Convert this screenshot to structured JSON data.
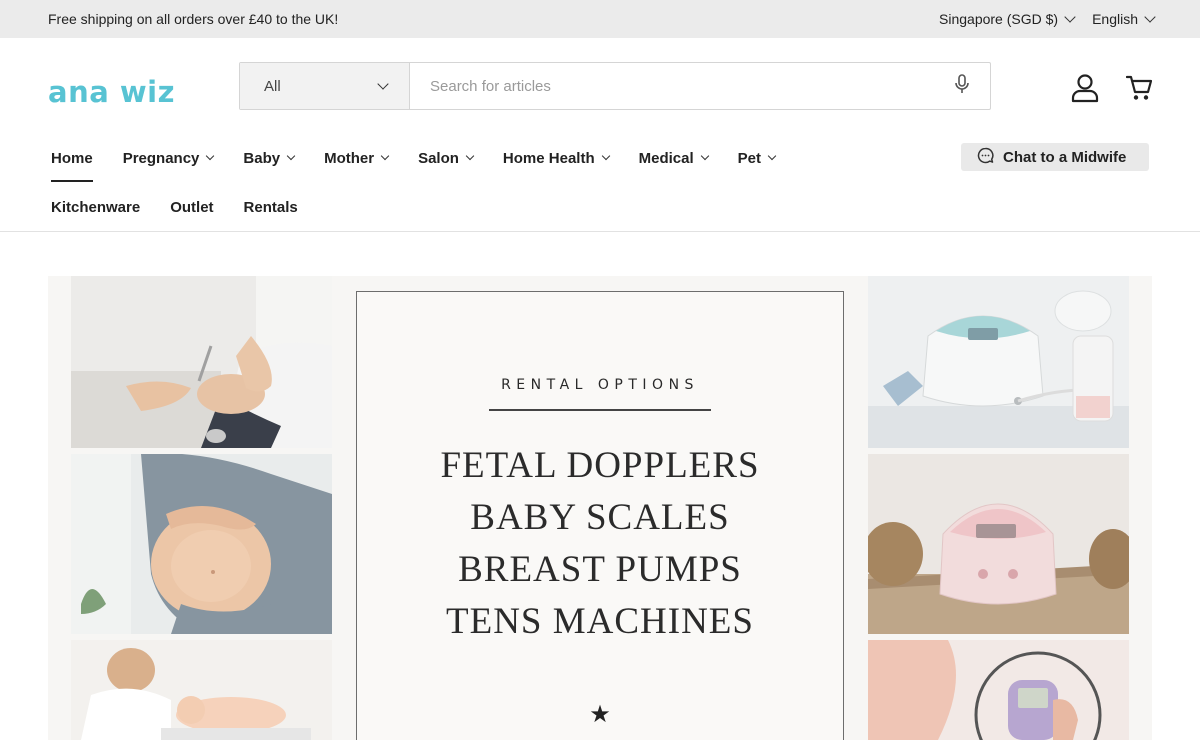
{
  "announcement": {
    "text": "Free shipping on all orders over £40 to the UK!",
    "region": "Singapore (SGD $)",
    "language": "English"
  },
  "header": {
    "logo": "ana wiz",
    "search": {
      "category": "All",
      "placeholder": "Search for articles"
    },
    "icons": [
      "microphone-icon",
      "account-icon",
      "cart-icon"
    ]
  },
  "nav": {
    "row1": [
      {
        "label": "Home",
        "active": true,
        "dropdown": false
      },
      {
        "label": "Pregnancy",
        "dropdown": true
      },
      {
        "label": "Baby",
        "dropdown": true
      },
      {
        "label": "Mother",
        "dropdown": true
      },
      {
        "label": "Salon",
        "dropdown": true
      },
      {
        "label": "Home Health",
        "dropdown": true
      },
      {
        "label": "Medical",
        "dropdown": true
      },
      {
        "label": "Pet",
        "dropdown": true
      }
    ],
    "row2": [
      {
        "label": "Kitchenware"
      },
      {
        "label": "Outlet"
      },
      {
        "label": "Rentals"
      }
    ],
    "chat_button": "Chat to a Midwife"
  },
  "hero": {
    "eyebrow": "RENTAL OPTIONS",
    "lines": [
      "FETAL DOPPLERS",
      "BABY SCALES",
      "BREAST PUMPS",
      "TENS MACHINES"
    ]
  },
  "colors": {
    "brand": "#58c3d3",
    "topbar": "#ebebeb",
    "chat_button": "#e9e9e9"
  }
}
